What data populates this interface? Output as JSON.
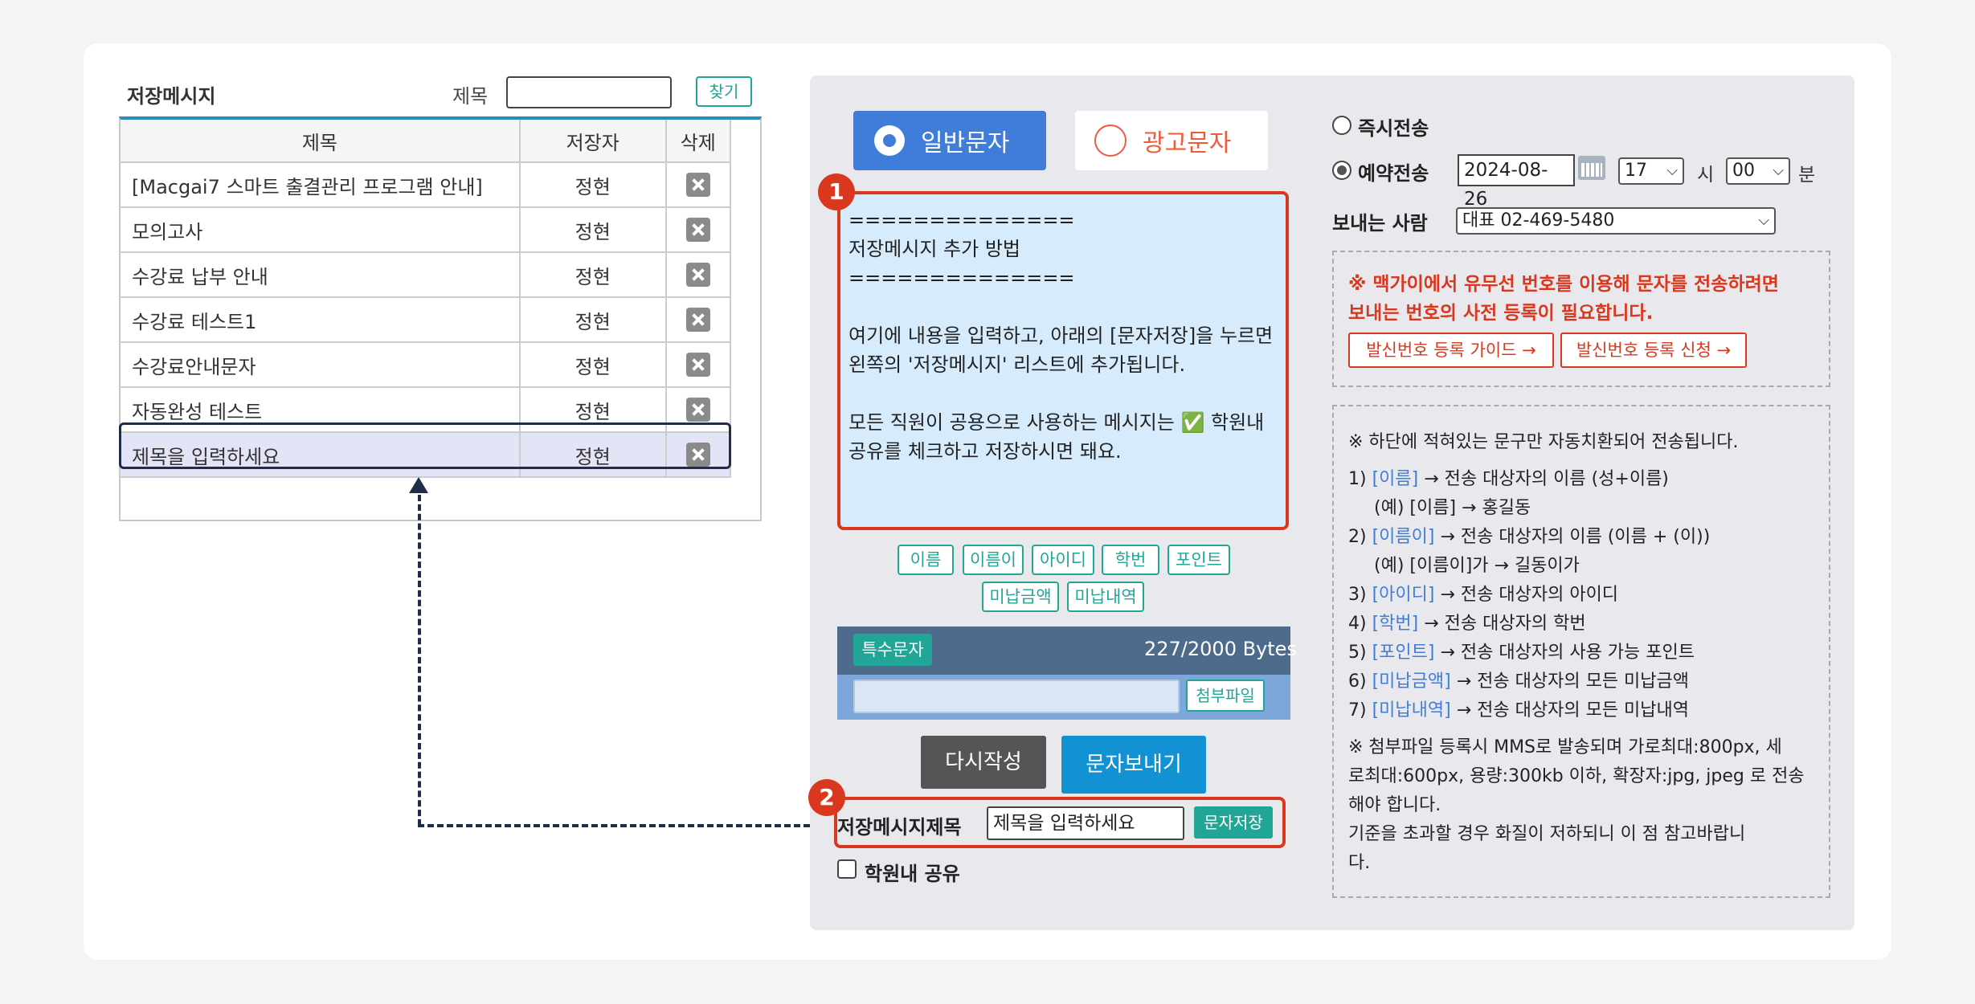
{
  "left": {
    "title": "저장메시지",
    "search_label": "제목",
    "search_value": "",
    "find_label": "찾기",
    "columns": [
      "제목",
      "저장자",
      "삭제"
    ],
    "rows": [
      {
        "title": "[Macgai7 스마트 출결관리 프로그램 안내]",
        "user": "정현"
      },
      {
        "title": "모의고사",
        "user": "정현"
      },
      {
        "title": "수강료 납부 안내",
        "user": "정현"
      },
      {
        "title": "수강료 테스트1",
        "user": "정현"
      },
      {
        "title": "수강료안내문자",
        "user": "정현"
      },
      {
        "title": "자동완성 테스트",
        "user": "정현"
      },
      {
        "title": "제목을 입력하세요",
        "user": "정현"
      }
    ]
  },
  "compose": {
    "type_normal": "일반문자",
    "type_ad": "광고문자",
    "badge1": "1",
    "badge2": "2",
    "message": "==============\n저장메시지 추가 방법\n==============\n\n여기에 내용을 입력하고, 아래의 [문자저장]을 누르면 왼쪽의 '저장메시지' 리스트에 추가됩니다.\n\n모든 직원이 공용으로 사용하는 메시지는 ✅ 학원내 공유를 체크하고 저장하시면 돼요.",
    "tags": [
      "이름",
      "이름이",
      "아이디",
      "학번",
      "포인트",
      "미납금액",
      "미납내역"
    ],
    "special_char": "특수문자",
    "bytes": "227/2000 Bytes",
    "attach": "첨부파일",
    "rewrite": "다시작성",
    "send": "문자보내기",
    "save_title_label": "저장메시지제목",
    "save_title_value": "제목을 입력하세요",
    "save_button": "문자저장",
    "share_label": "학원내 공유"
  },
  "settings": {
    "immediate": "즉시전송",
    "reserved": "예약전송",
    "date": "2024-08-26",
    "hour": "17",
    "hour_unit": "시",
    "minute": "00",
    "minute_unit": "분",
    "sender_label": "보내는 사람",
    "sender_value": "대표 02-469-5480",
    "notice_line1": "※ 맥가이에서 유무선 번호를 이용해 문자를 전송하려면",
    "notice_line2": "보내는 번호의 사전 등록이 필요합니다.",
    "link_guide": "발신번호 등록 가이드 →",
    "link_apply": "발신번호 등록 신청 →",
    "info_header": "※ 하단에 적혀있는 문구만 자동치환되어 전송됩니다.",
    "items": [
      {
        "num": "1)",
        "kw": "[이름]",
        "text": " → 전송 대상자의 이름 (성+이름)"
      },
      {
        "num": "",
        "kw": "",
        "text": "(예) [이름] → 홍길동"
      },
      {
        "num": "2)",
        "kw": "[이름이]",
        "text": " → 전송 대상자의 이름 (이름 + (이))"
      },
      {
        "num": "",
        "kw": "",
        "text": "(예) [이름이]가 → 길동이가"
      },
      {
        "num": "3)",
        "kw": "[아이디]",
        "text": " → 전송 대상자의 아이디"
      },
      {
        "num": "4)",
        "kw": "[학번]",
        "text": " → 전송 대상자의 학번"
      },
      {
        "num": "5)",
        "kw": "[포인트]",
        "text": " → 전송 대상자의 사용 가능 포인트"
      },
      {
        "num": "6)",
        "kw": "[미납금액]",
        "text": " → 전송 대상자의 모든 미납금액"
      },
      {
        "num": "7)",
        "kw": "[미납내역]",
        "text": " → 전송 대상자의 모든 미납내역"
      }
    ],
    "footer_lines": [
      "※ 첨부파일 등록시 MMS로 발송되며 가로최대:800px, 세",
      "로최대:600px, 용량:300kb 이하, 확장자:jpg, jpeg 로 전송",
      "해야 합니다.",
      "기준을 초과할 경우 화질이 저하되니 이 점 참고바랍니",
      "다."
    ]
  }
}
